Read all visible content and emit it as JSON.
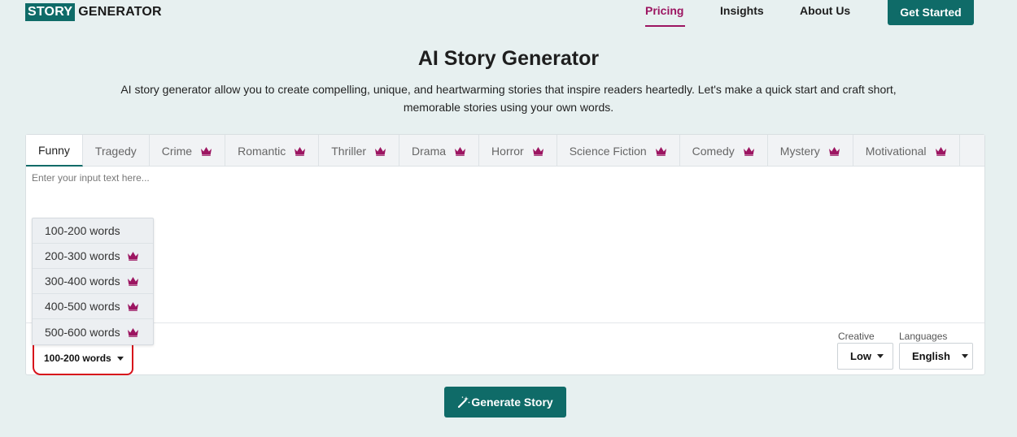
{
  "header": {
    "logo_box": "STORY",
    "logo_rest": "GENERATOR",
    "nav": [
      "Pricing",
      "Insights",
      "About Us"
    ],
    "cta": "Get Started"
  },
  "hero": {
    "title": "AI Story Generator",
    "subtitle": "AI story generator allow you to create compelling, unique, and heartwarming stories that inspire readers heartedly. Let's make a quick start and craft short, memorable stories using your own words."
  },
  "tabs": [
    {
      "label": "Funny",
      "premium": false
    },
    {
      "label": "Tragedy",
      "premium": false
    },
    {
      "label": "Crime",
      "premium": true
    },
    {
      "label": "Romantic",
      "premium": true
    },
    {
      "label": "Thriller",
      "premium": true
    },
    {
      "label": "Drama",
      "premium": true
    },
    {
      "label": "Horror",
      "premium": true
    },
    {
      "label": "Science Fiction",
      "premium": true
    },
    {
      "label": "Comedy",
      "premium": true
    },
    {
      "label": "Mystery",
      "premium": true
    },
    {
      "label": "Motivational",
      "premium": true
    }
  ],
  "input": {
    "placeholder": "Enter your input text here..."
  },
  "word_count": {
    "selected": "100-200 words",
    "options": [
      {
        "label": "100-200 words",
        "premium": false
      },
      {
        "label": "200-300 words",
        "premium": true
      },
      {
        "label": "300-400 words",
        "premium": true
      },
      {
        "label": "400-500 words",
        "premium": true
      },
      {
        "label": "500-600 words",
        "premium": true
      }
    ]
  },
  "creative": {
    "label": "Creative",
    "value": "Low"
  },
  "languages": {
    "label": "Languages",
    "value": "English"
  },
  "generate": {
    "label": "Generate Story"
  },
  "colors": {
    "brand": "#0f6b68",
    "accent": "#9c1561",
    "annotation": "#d7121b"
  },
  "icons": {
    "premium": "crown-icon",
    "generate": "magic-wand-icon",
    "dropdown": "caret-down-icon"
  }
}
